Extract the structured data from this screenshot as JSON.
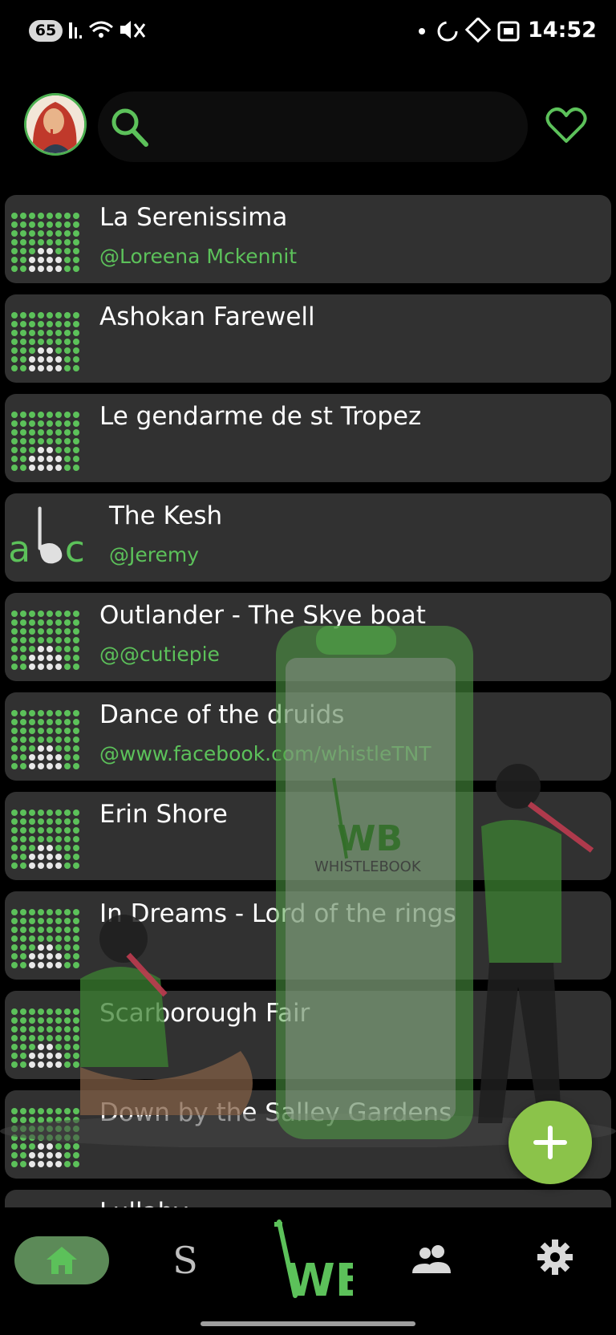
{
  "status_bar": {
    "battery": "65",
    "time": "14:52"
  },
  "search": {
    "placeholder": ""
  },
  "songs": [
    {
      "title": "La Serenissima",
      "author": "@Loreena Mckennit",
      "icon": "tablature-dots-icon"
    },
    {
      "title": "Ashokan Farewell",
      "author": "",
      "icon": "tablature-dots-icon"
    },
    {
      "title": "Le gendarme de st Tropez",
      "author": "",
      "icon": "tablature-dots-icon"
    },
    {
      "title": "The Kesh",
      "author": "@Jeremy",
      "icon": "abc-notation-icon"
    },
    {
      "title": "Outlander - The Skye boat",
      "author": "@@cutiepie",
      "icon": "tablature-dots-icon"
    },
    {
      "title": "Dance of the druids",
      "author": "@www.facebook.com/whistleTNT",
      "icon": "tablature-dots-icon"
    },
    {
      "title": "Erin Shore",
      "author": "",
      "icon": "tablature-dots-icon"
    },
    {
      "title": "In Dreams - Lord of the rings",
      "author": "",
      "icon": "tablature-dots-icon"
    },
    {
      "title": "Scarborough Fair",
      "author": "",
      "icon": "tablature-dots-icon"
    },
    {
      "title": "Down by the Salley Gardens",
      "author": "",
      "icon": "tablature-dots-icon"
    },
    {
      "title": "Lullaby",
      "author": "",
      "icon": "tablature-dots-icon"
    }
  ],
  "bottom_nav": {
    "s_label": "S",
    "wb_label": "WB",
    "active": "home"
  },
  "illustration": {
    "brand": "WB",
    "brand_sub": "WHISTLEBOOK"
  },
  "colors": {
    "accent": "#5cc15a",
    "fab": "#8bc34a",
    "row_bg": "#313131",
    "nav_active": "#5c8a58"
  }
}
